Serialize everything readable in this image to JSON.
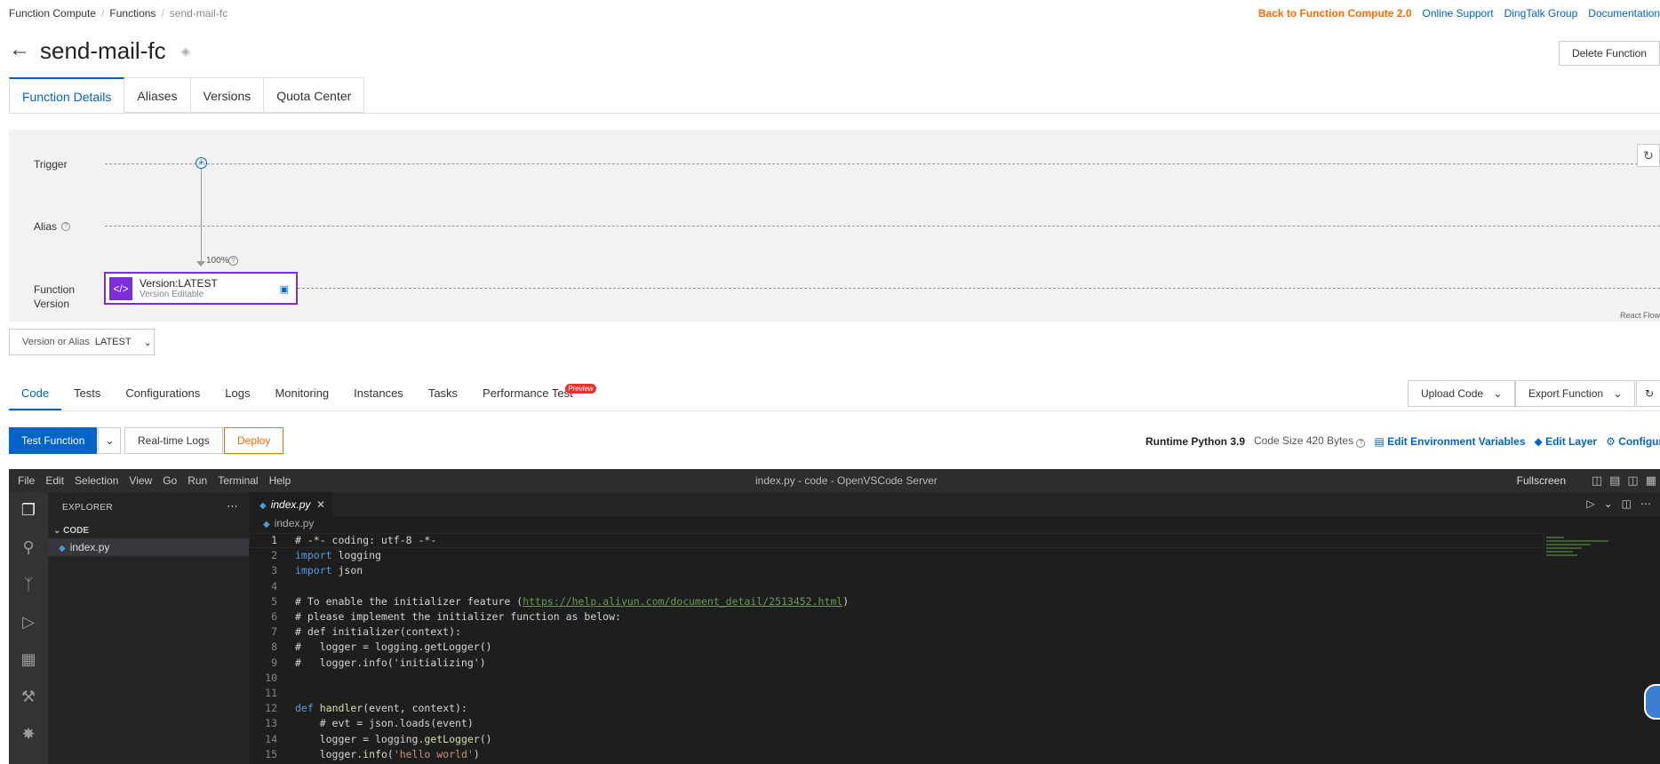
{
  "breadcrumb": [
    "Function Compute",
    "Functions",
    "send-mail-fc"
  ],
  "top_links": [
    "Back to Function Compute 2.0",
    "Online Support",
    "DingTalk Group",
    "Documentation"
  ],
  "page_title": "send-mail-fc",
  "delete_button": "Delete Function",
  "main_tabs": [
    "Function Details",
    "Aliases",
    "Versions",
    "Quota Center"
  ],
  "flow": {
    "trigger_label": "Trigger",
    "alias_label": "Alias",
    "function_version_label": "Function Version",
    "percentage": "100%",
    "version_title": "Version:LATEST",
    "version_subtitle": "Version Editable",
    "react_flow": "React Flow"
  },
  "version_select": {
    "label": "Version or Alias",
    "value": "LATEST"
  },
  "code_tabs": [
    "Code",
    "Tests",
    "Configurations",
    "Logs",
    "Monitoring",
    "Instances",
    "Tasks",
    "Performance Test"
  ],
  "preview_badge": "Preview",
  "upload_code": "Upload Code",
  "export_function": "Export Function",
  "actions": {
    "test_function": "Test Function",
    "realtime_logs": "Real-time Logs",
    "deploy": "Deploy"
  },
  "runtime_info": {
    "runtime": "Runtime Python 3.9",
    "code_size": "Code Size 420 Bytes",
    "edit_env": "Edit Environment Variables",
    "edit_layer": "Edit Layer",
    "configure_webide": "Configure WebIDE"
  },
  "vscode": {
    "menu": [
      "File",
      "Edit",
      "Selection",
      "View",
      "Go",
      "Run",
      "Terminal",
      "Help"
    ],
    "title": "index.py - code - OpenVSCode Server",
    "fullscreen": "Fullscreen",
    "explorer_head": "EXPLORER",
    "explorer_folder": "CODE",
    "explorer_file": "index.py",
    "tab_name": "index.py",
    "breadcrumb_file": "index.py"
  },
  "code_lines": [
    "# -*- coding: utf-8 -*-",
    "import logging",
    "import json",
    "",
    "# To enable the initializer feature (https://help.aliyun.com/document_detail/2513452.html)",
    "# please implement the initializer function as below:",
    "# def initializer(context):",
    "#   logger = logging.getLogger()",
    "#   logger.info('initializing')",
    "",
    "",
    "def handler(event, context):",
    "    # evt = json.loads(event)",
    "    logger = logging.getLogger()",
    "    logger.info('hello world')"
  ]
}
